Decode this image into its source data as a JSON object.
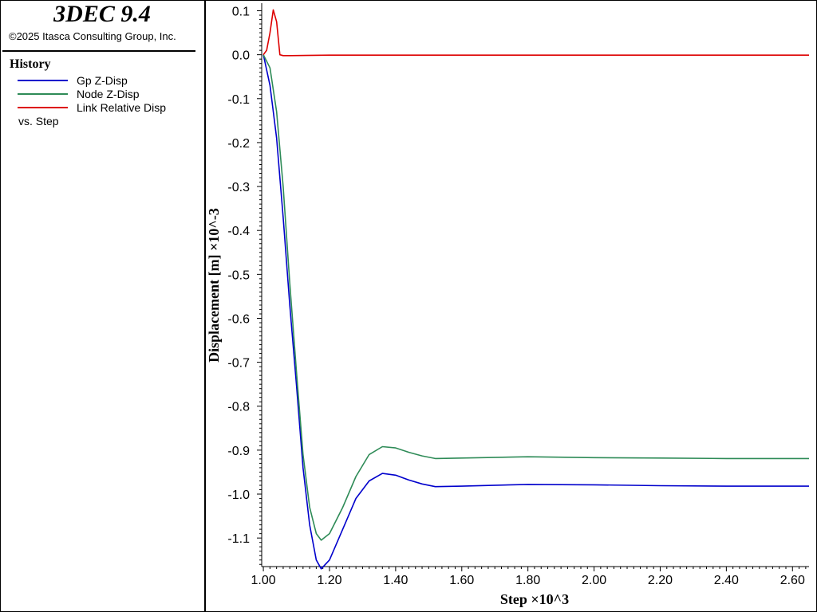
{
  "app": {
    "title": "3DEC 9.4",
    "copyright": "©2025 Itasca Consulting Group, Inc."
  },
  "legend": {
    "heading": "History",
    "items": [
      {
        "label": "Gp Z-Disp",
        "color": "#0000cc"
      },
      {
        "label": "Node Z-Disp",
        "color": "#2e8b57"
      },
      {
        "label": "Link Relative Disp",
        "color": "#dd0000"
      }
    ],
    "vs_label": "vs. Step"
  },
  "chart_data": {
    "type": "line",
    "xlabel": "Step ×10^3",
    "ylabel": "Displacement [m] ×10^-3",
    "xlim": [
      0.995,
      2.65
    ],
    "ylim": [
      -1.165,
      0.11
    ],
    "x_ticks": [
      "1.00",
      "1.20",
      "1.40",
      "1.60",
      "1.80",
      "2.00",
      "2.20",
      "2.40",
      "2.60"
    ],
    "y_ticks": [
      "0.1",
      "0.0",
      "-0.1",
      "-0.2",
      "-0.3",
      "-0.4",
      "-0.5",
      "-0.6",
      "-0.7",
      "-0.8",
      "-0.9",
      "-1.0",
      "-1.1"
    ],
    "grid": false,
    "series": [
      {
        "name": "Gp Z-Disp",
        "color": "#0000cc",
        "x": [
          1.0,
          1.02,
          1.04,
          1.06,
          1.08,
          1.1,
          1.12,
          1.14,
          1.16,
          1.175,
          1.2,
          1.24,
          1.28,
          1.32,
          1.36,
          1.4,
          1.44,
          1.48,
          1.52,
          1.6,
          1.8,
          2.0,
          2.2,
          2.4,
          2.65
        ],
        "y": [
          0.0,
          -0.07,
          -0.19,
          -0.37,
          -0.57,
          -0.75,
          -0.94,
          -1.07,
          -1.15,
          -1.17,
          -1.15,
          -1.08,
          -1.01,
          -0.97,
          -0.953,
          -0.957,
          -0.968,
          -0.977,
          -0.983,
          -0.982,
          -0.978,
          -0.979,
          -0.981,
          -0.982,
          -0.982
        ]
      },
      {
        "name": "Node Z-Disp",
        "color": "#2e8b57",
        "x": [
          1.0,
          1.02,
          1.04,
          1.06,
          1.08,
          1.1,
          1.12,
          1.14,
          1.16,
          1.175,
          1.2,
          1.24,
          1.28,
          1.32,
          1.36,
          1.4,
          1.44,
          1.48,
          1.52,
          1.6,
          1.8,
          2.0,
          2.2,
          2.4,
          2.65
        ],
        "y": [
          0.0,
          -0.03,
          -0.13,
          -0.3,
          -0.52,
          -0.72,
          -0.91,
          -1.03,
          -1.09,
          -1.105,
          -1.09,
          -1.03,
          -0.96,
          -0.91,
          -0.892,
          -0.895,
          -0.905,
          -0.913,
          -0.919,
          -0.918,
          -0.915,
          -0.917,
          -0.918,
          -0.919,
          -0.919
        ]
      },
      {
        "name": "Link Relative Disp",
        "color": "#dd0000",
        "x": [
          1.0,
          1.01,
          1.02,
          1.03,
          1.04,
          1.05,
          1.06,
          1.08,
          1.2,
          1.6,
          2.0,
          2.65
        ],
        "y": [
          0.0,
          0.01,
          0.05,
          0.102,
          0.075,
          0.0,
          -0.002,
          -0.002,
          -0.001,
          -0.001,
          -0.001,
          -0.001
        ]
      }
    ]
  }
}
